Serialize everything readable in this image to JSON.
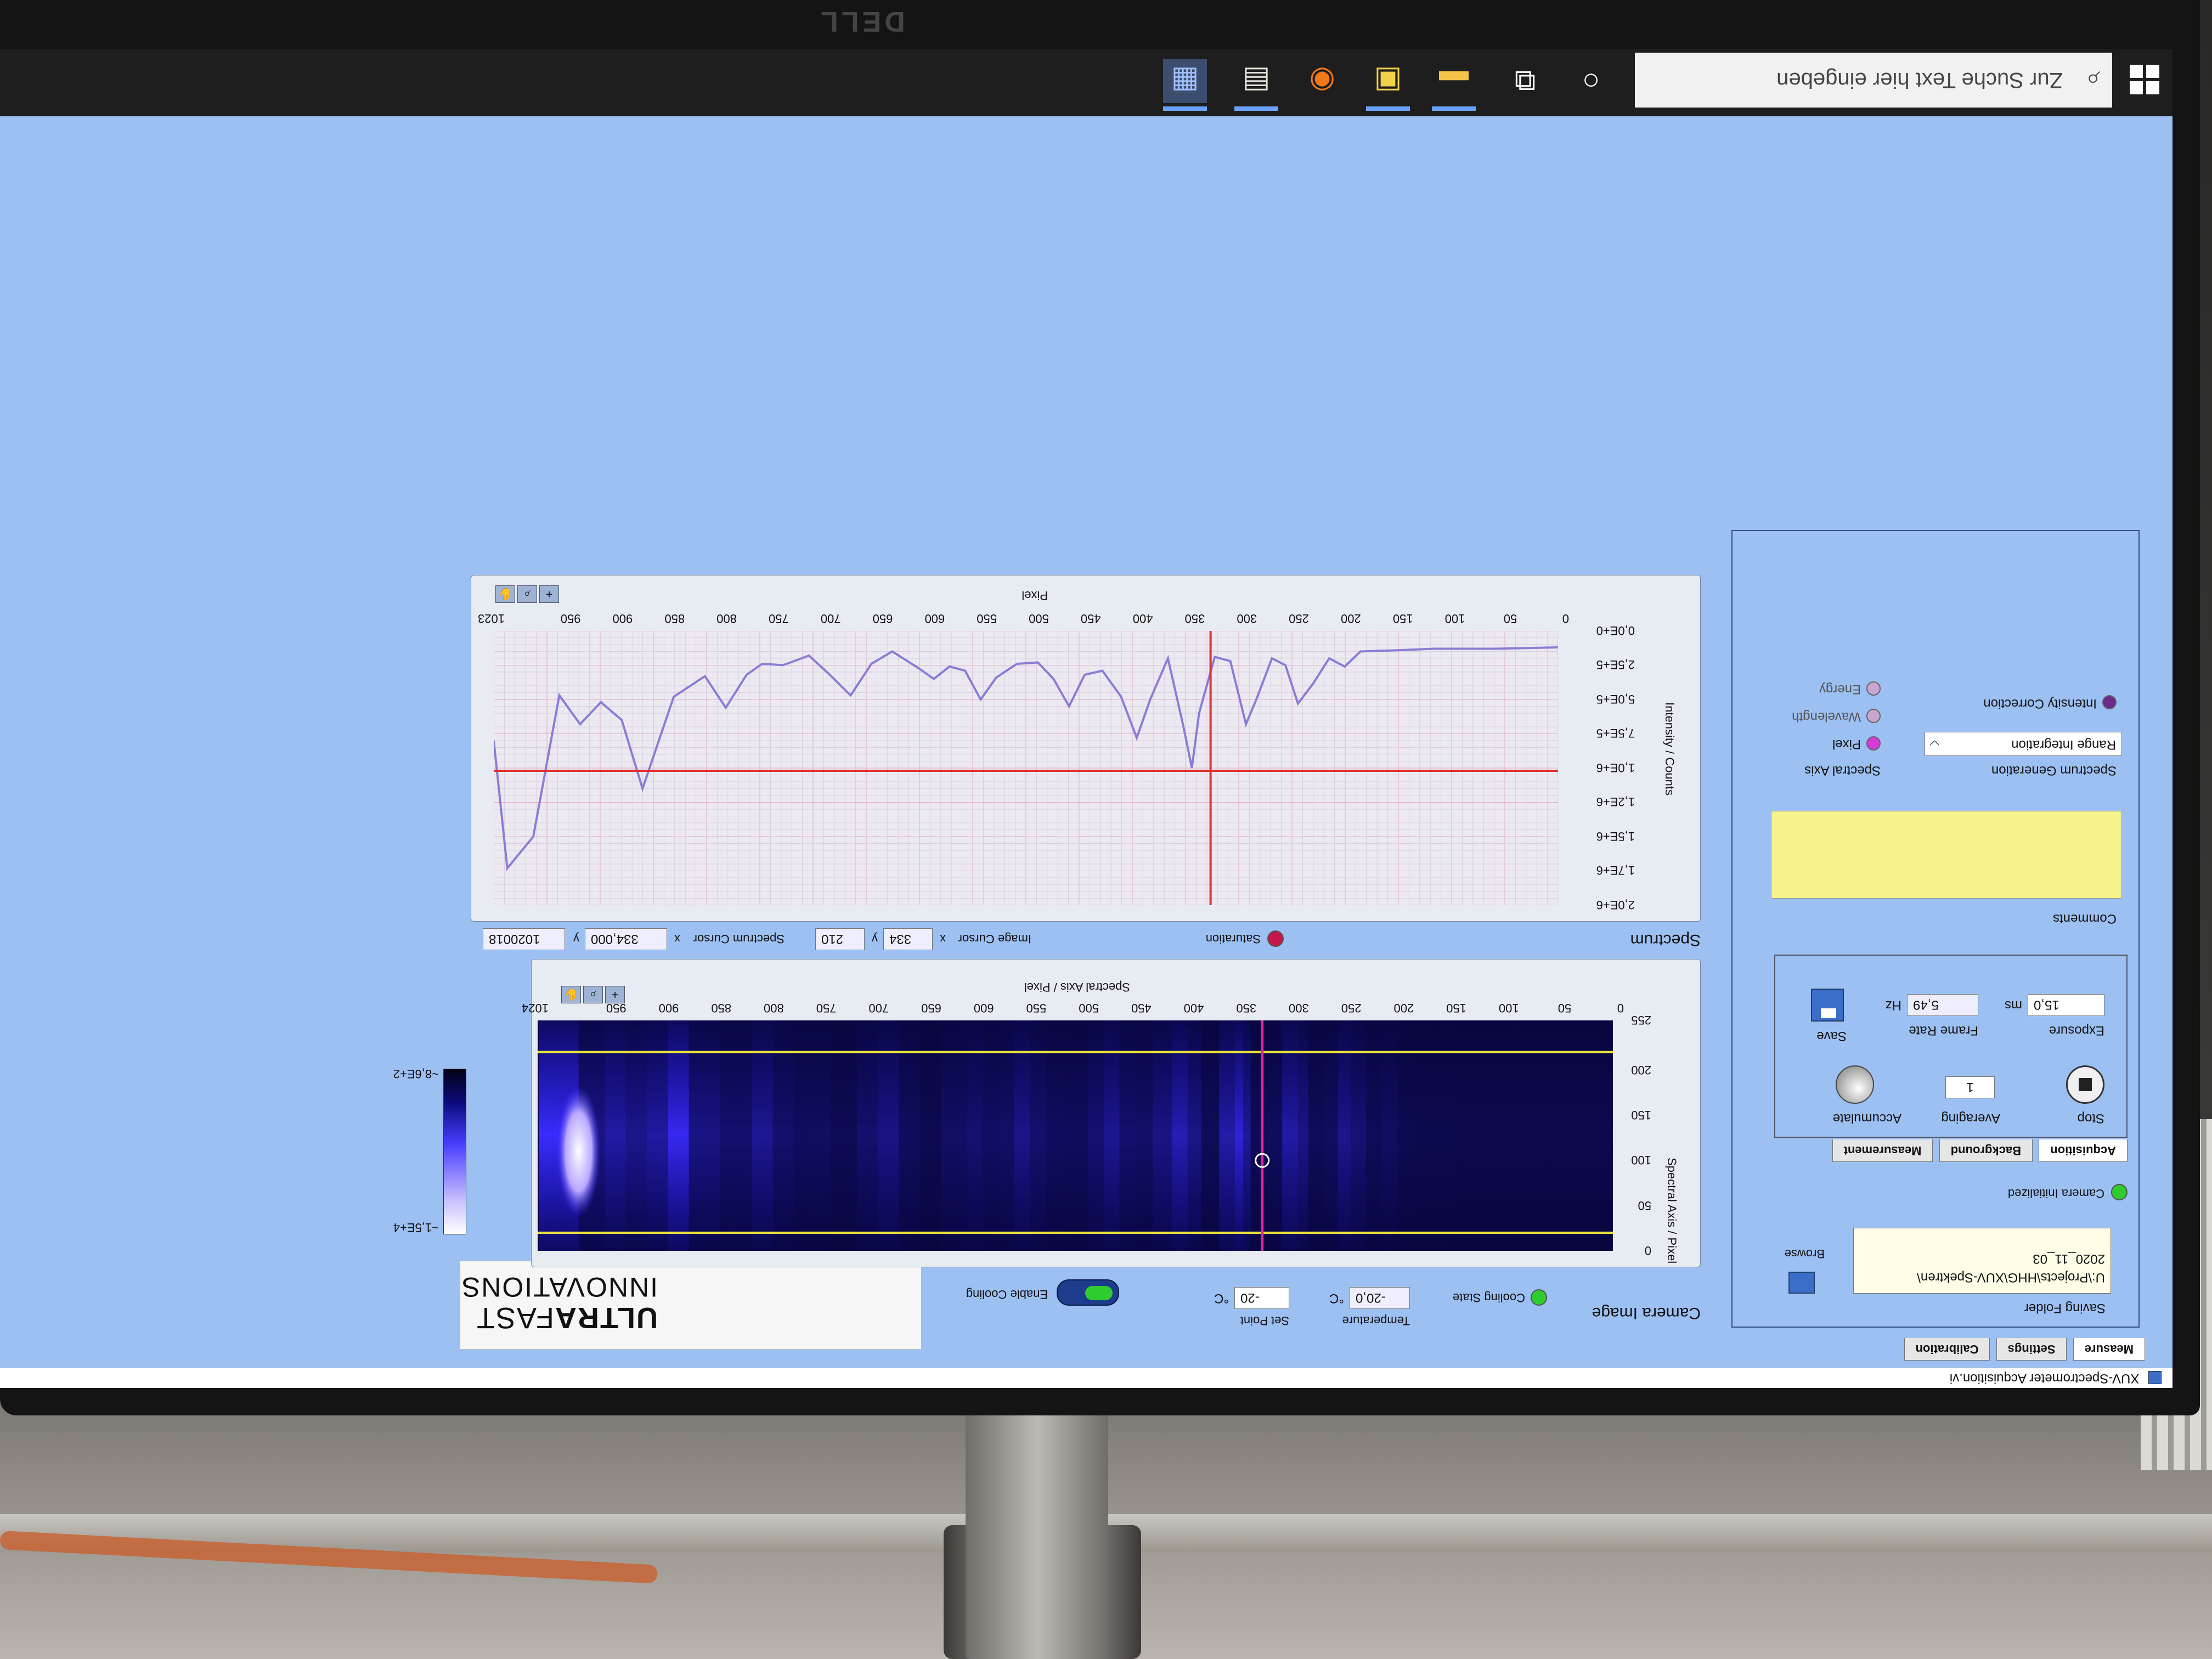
{
  "monitor": {
    "brand": "DELL"
  },
  "taskbar": {
    "search_placeholder": "Zur Suche Text hier eingeben",
    "icons": [
      "windows-start-icon",
      "search-icon",
      "cortana-icon",
      "task-view-icon",
      "file-explorer-icon",
      "labview-icon",
      "chrome-icon",
      "image-viewer-icon",
      "xuv-app-icon"
    ]
  },
  "window": {
    "title": "XUV-Spectrometer Acquisition.vi"
  },
  "tabs": [
    {
      "label": "Measure"
    },
    {
      "label": "Settings"
    },
    {
      "label": "Calibration"
    }
  ],
  "saving": {
    "folder_label": "Saving Folder",
    "folder_path_line1": "U:\\Projects\\HHG\\XUV-Spektren\\",
    "folder_path_line2": "2020_11_03",
    "browse_label": "Browse",
    "camera_initialized_label": "Camera Initialized"
  },
  "acq_tabs": [
    {
      "label": "Acquisition"
    },
    {
      "label": "Background"
    },
    {
      "label": "Measurement"
    }
  ],
  "acquisition": {
    "stop_label": "Stop",
    "averaging_label": "Averaging",
    "averaging_value": "1",
    "accumulate_label": "Accumulate",
    "exposure_label": "Exposure",
    "exposure_value": "15,0",
    "exposure_unit": "ms",
    "frame_rate_label": "Frame Rate",
    "frame_rate_value": "5,49",
    "frame_rate_unit": "Hz",
    "save_label": "Save"
  },
  "comments": {
    "label": "Comments",
    "value": ""
  },
  "spectrum_generation": {
    "label": "Spectrum Generation",
    "selected": "Range Integration",
    "intensity_correction_label": "Intensity Correction",
    "spectral_axis_label": "Spectral Axis",
    "axis_options": [
      {
        "label": "Pixel"
      },
      {
        "label": "Wavelength"
      },
      {
        "label": "Energy"
      }
    ]
  },
  "camera_image": {
    "title": "Camera Image",
    "cooling_state_label": "Cooling State",
    "temperature_label": "Temperature",
    "temperature_value": "-20,0",
    "temperature_unit": "°C",
    "set_point_label": "Set Point",
    "set_point_value": "-20",
    "set_point_unit": "°C",
    "enable_cooling_label": "Enable Cooling",
    "x_label": "Spectral Axis / Pixel",
    "y_label": "Spectral Axis / Pixel",
    "x_ticks": [
      "0",
      "50",
      "100",
      "150",
      "200",
      "250",
      "300",
      "350",
      "400",
      "450",
      "500",
      "550",
      "600",
      "650",
      "700",
      "750",
      "800",
      "850",
      "900",
      "950",
      "1024"
    ],
    "y_ticks": [
      "0",
      "50",
      "100",
      "150",
      "200",
      "255"
    ],
    "colorbar_min": "~1,5E+4",
    "colorbar_max": "~8,6E+2"
  },
  "logo": {
    "line1_a": "ULTRA",
    "line1_b": "FAST",
    "line2": "INNOVATIONS"
  },
  "cursors": {
    "saturation_label": "Saturation",
    "image_cursor_label": "Image Cursor",
    "x_label": "x",
    "image_x": "334",
    "y_label": "y",
    "image_y": "210",
    "spectrum_cursor_label": "Spectrum Cursor",
    "spectrum_x": "334,000",
    "spectrum_y": "1020018"
  },
  "spectrum": {
    "title": "Spectrum",
    "x_label": "Pixel",
    "y_label": "Intensity / Counts",
    "x_ticks": [
      "0",
      "50",
      "100",
      "150",
      "200",
      "250",
      "300",
      "350",
      "400",
      "450",
      "500",
      "550",
      "600",
      "650",
      "700",
      "750",
      "800",
      "850",
      "900",
      "950",
      "1023"
    ],
    "y_ticks": [
      "0,0E+0",
      "2,5E+5",
      "5,0E+5",
      "7,5E+5",
      "1,0E+6",
      "1,2E+6",
      "1,5E+6",
      "1,7E+6",
      "2,0E+6"
    ]
  },
  "chart_data": {
    "type": "line",
    "xlim": [
      0,
      1023
    ],
    "ylim": [
      0,
      2000000
    ],
    "grid": true,
    "series": [
      {
        "color": "#8a7dd6",
        "x": [
          0,
          60,
          120,
          150,
          190,
          205,
          220,
          235,
          250,
          262,
          275,
          290,
          300,
          315,
          330,
          345,
          352,
          360,
          375,
          392,
          405,
          420,
          438,
          455,
          470,
          485,
          500,
          520,
          540,
          555,
          570,
          585,
          600,
          615,
          640,
          660,
          680,
          700,
          720,
          745,
          765,
          780,
          800,
          820,
          850,
          880,
          900,
          920,
          940,
          960,
          985,
          1010,
          1023
        ],
        "y": [
          120000,
          130000,
          130000,
          140000,
          150000,
          260000,
          200000,
          380000,
          530000,
          250000,
          200000,
          500000,
          680000,
          220000,
          190000,
          600000,
          1000000,
          700000,
          200000,
          500000,
          780000,
          480000,
          290000,
          320000,
          550000,
          350000,
          230000,
          240000,
          340000,
          500000,
          290000,
          260000,
          350000,
          270000,
          150000,
          240000,
          470000,
          320000,
          180000,
          250000,
          240000,
          320000,
          560000,
          330000,
          480000,
          1150000,
          650000,
          520000,
          680000,
          470000,
          1500000,
          1730000,
          800000
        ]
      }
    ],
    "cursor": {
      "x": 334,
      "y": 1020018,
      "color": "#e03030"
    },
    "camera_cursor": {
      "x": 334,
      "y": 210
    },
    "camera_roi_lines_y": [
      20,
      220
    ]
  },
  "colors": {
    "screen_bg": "#9cc0f2",
    "comments_bg": "#f6f38a",
    "led_on": "#2ecc2e",
    "cursor": "#e03030",
    "roi_line": "#e8e23a"
  }
}
